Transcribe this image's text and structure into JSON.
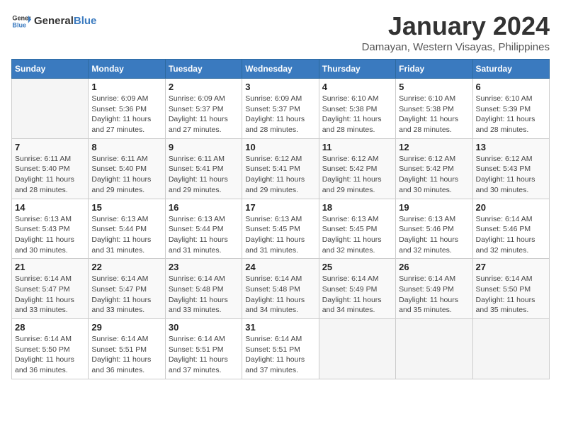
{
  "header": {
    "logo_general": "General",
    "logo_blue": "Blue",
    "month_title": "January 2024",
    "location": "Damayan, Western Visayas, Philippines"
  },
  "calendar": {
    "days_of_week": [
      "Sunday",
      "Monday",
      "Tuesday",
      "Wednesday",
      "Thursday",
      "Friday",
      "Saturday"
    ],
    "weeks": [
      [
        {
          "num": "",
          "detail": ""
        },
        {
          "num": "1",
          "detail": "Sunrise: 6:09 AM\nSunset: 5:36 PM\nDaylight: 11 hours\nand 27 minutes."
        },
        {
          "num": "2",
          "detail": "Sunrise: 6:09 AM\nSunset: 5:37 PM\nDaylight: 11 hours\nand 27 minutes."
        },
        {
          "num": "3",
          "detail": "Sunrise: 6:09 AM\nSunset: 5:37 PM\nDaylight: 11 hours\nand 28 minutes."
        },
        {
          "num": "4",
          "detail": "Sunrise: 6:10 AM\nSunset: 5:38 PM\nDaylight: 11 hours\nand 28 minutes."
        },
        {
          "num": "5",
          "detail": "Sunrise: 6:10 AM\nSunset: 5:38 PM\nDaylight: 11 hours\nand 28 minutes."
        },
        {
          "num": "6",
          "detail": "Sunrise: 6:10 AM\nSunset: 5:39 PM\nDaylight: 11 hours\nand 28 minutes."
        }
      ],
      [
        {
          "num": "7",
          "detail": "Sunrise: 6:11 AM\nSunset: 5:40 PM\nDaylight: 11 hours\nand 28 minutes."
        },
        {
          "num": "8",
          "detail": "Sunrise: 6:11 AM\nSunset: 5:40 PM\nDaylight: 11 hours\nand 29 minutes."
        },
        {
          "num": "9",
          "detail": "Sunrise: 6:11 AM\nSunset: 5:41 PM\nDaylight: 11 hours\nand 29 minutes."
        },
        {
          "num": "10",
          "detail": "Sunrise: 6:12 AM\nSunset: 5:41 PM\nDaylight: 11 hours\nand 29 minutes."
        },
        {
          "num": "11",
          "detail": "Sunrise: 6:12 AM\nSunset: 5:42 PM\nDaylight: 11 hours\nand 29 minutes."
        },
        {
          "num": "12",
          "detail": "Sunrise: 6:12 AM\nSunset: 5:42 PM\nDaylight: 11 hours\nand 30 minutes."
        },
        {
          "num": "13",
          "detail": "Sunrise: 6:12 AM\nSunset: 5:43 PM\nDaylight: 11 hours\nand 30 minutes."
        }
      ],
      [
        {
          "num": "14",
          "detail": "Sunrise: 6:13 AM\nSunset: 5:43 PM\nDaylight: 11 hours\nand 30 minutes."
        },
        {
          "num": "15",
          "detail": "Sunrise: 6:13 AM\nSunset: 5:44 PM\nDaylight: 11 hours\nand 31 minutes."
        },
        {
          "num": "16",
          "detail": "Sunrise: 6:13 AM\nSunset: 5:44 PM\nDaylight: 11 hours\nand 31 minutes."
        },
        {
          "num": "17",
          "detail": "Sunrise: 6:13 AM\nSunset: 5:45 PM\nDaylight: 11 hours\nand 31 minutes."
        },
        {
          "num": "18",
          "detail": "Sunrise: 6:13 AM\nSunset: 5:45 PM\nDaylight: 11 hours\nand 32 minutes."
        },
        {
          "num": "19",
          "detail": "Sunrise: 6:13 AM\nSunset: 5:46 PM\nDaylight: 11 hours\nand 32 minutes."
        },
        {
          "num": "20",
          "detail": "Sunrise: 6:14 AM\nSunset: 5:46 PM\nDaylight: 11 hours\nand 32 minutes."
        }
      ],
      [
        {
          "num": "21",
          "detail": "Sunrise: 6:14 AM\nSunset: 5:47 PM\nDaylight: 11 hours\nand 33 minutes."
        },
        {
          "num": "22",
          "detail": "Sunrise: 6:14 AM\nSunset: 5:47 PM\nDaylight: 11 hours\nand 33 minutes."
        },
        {
          "num": "23",
          "detail": "Sunrise: 6:14 AM\nSunset: 5:48 PM\nDaylight: 11 hours\nand 33 minutes."
        },
        {
          "num": "24",
          "detail": "Sunrise: 6:14 AM\nSunset: 5:48 PM\nDaylight: 11 hours\nand 34 minutes."
        },
        {
          "num": "25",
          "detail": "Sunrise: 6:14 AM\nSunset: 5:49 PM\nDaylight: 11 hours\nand 34 minutes."
        },
        {
          "num": "26",
          "detail": "Sunrise: 6:14 AM\nSunset: 5:49 PM\nDaylight: 11 hours\nand 35 minutes."
        },
        {
          "num": "27",
          "detail": "Sunrise: 6:14 AM\nSunset: 5:50 PM\nDaylight: 11 hours\nand 35 minutes."
        }
      ],
      [
        {
          "num": "28",
          "detail": "Sunrise: 6:14 AM\nSunset: 5:50 PM\nDaylight: 11 hours\nand 36 minutes."
        },
        {
          "num": "29",
          "detail": "Sunrise: 6:14 AM\nSunset: 5:51 PM\nDaylight: 11 hours\nand 36 minutes."
        },
        {
          "num": "30",
          "detail": "Sunrise: 6:14 AM\nSunset: 5:51 PM\nDaylight: 11 hours\nand 37 minutes."
        },
        {
          "num": "31",
          "detail": "Sunrise: 6:14 AM\nSunset: 5:51 PM\nDaylight: 11 hours\nand 37 minutes."
        },
        {
          "num": "",
          "detail": ""
        },
        {
          "num": "",
          "detail": ""
        },
        {
          "num": "",
          "detail": ""
        }
      ]
    ]
  }
}
